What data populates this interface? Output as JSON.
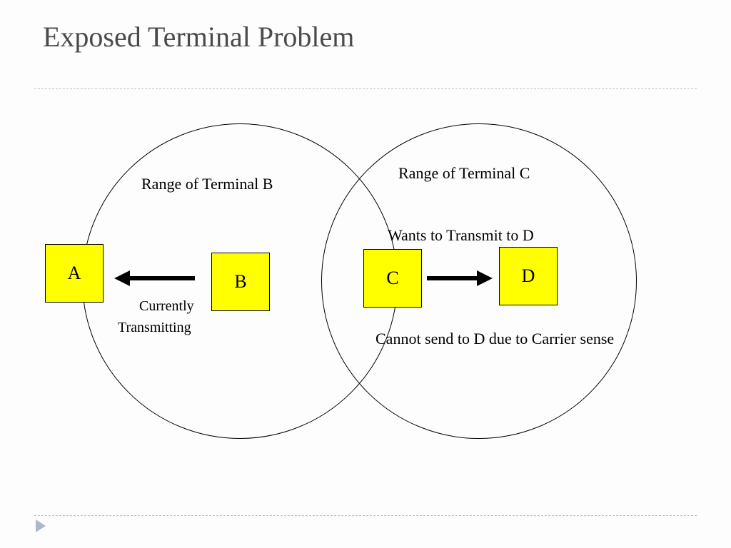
{
  "title": "Exposed Terminal Problem",
  "nodes": {
    "a": "A",
    "b": "B",
    "c": "C",
    "d": "D"
  },
  "labels": {
    "range_b": "Range of Terminal B",
    "range_c": "Range of Terminal C",
    "wants": "Wants to Transmit to D",
    "cannot": "Cannot send to D due to Carrier sense",
    "currently": "Currently",
    "transmitting": "Transmitting"
  },
  "colors": {
    "node_fill": "#ffff00",
    "title_text": "#4a4a4a",
    "divider": "#bfbfbf",
    "play_icon": "#a9b8cc"
  }
}
